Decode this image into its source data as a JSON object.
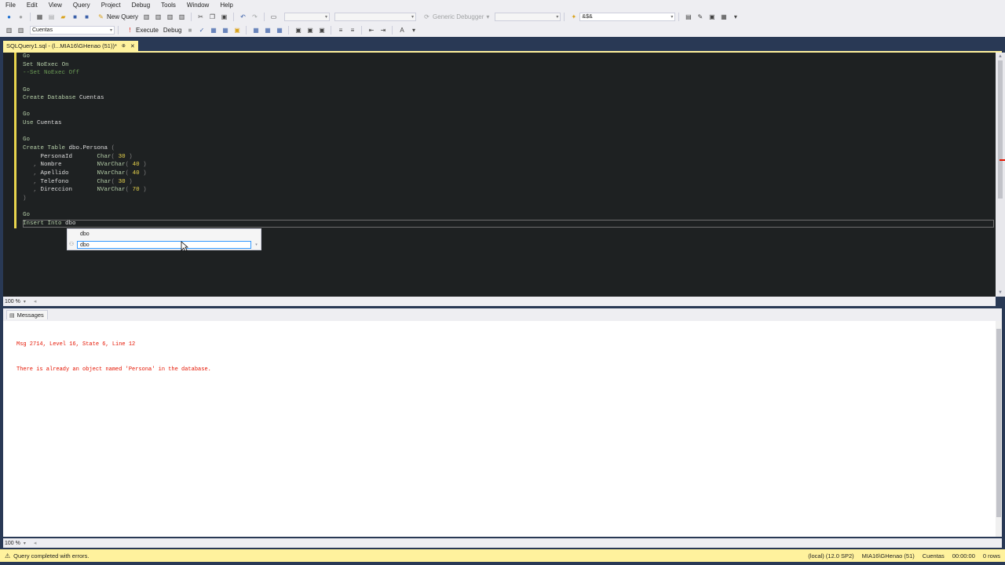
{
  "menu": [
    "File",
    "Edit",
    "View",
    "Query",
    "Project",
    "Debug",
    "Tools",
    "Window",
    "Help"
  ],
  "toolbar1": {
    "new_query_label": "New Query",
    "debugger_label": "Generic Debugger",
    "search_value": "&$&"
  },
  "toolbar2": {
    "database_value": "Cuentas",
    "execute_label": "Execute",
    "debug_label": "Debug"
  },
  "document_tab": {
    "title": "SQLQuery1.sql - (l...MIA16\\GHenao (51))*"
  },
  "editor": {
    "lines": [
      "Go",
      "Set NoExec On",
      "--Set NoExec Off",
      "",
      "Go",
      "Create Database Cuentas",
      "",
      "Go",
      "Use Cuentas",
      "",
      "Go",
      "Create Table dbo.Persona (",
      "     PersonaId       Char( 30 )",
      "   , Nombre          NVarChar( 40 )",
      "   , Apellido        NVarChar( 40 )",
      "   , Telefono        Char( 30 )",
      "   , Direccion       NVarChar( 70 )",
      ")",
      "",
      "Go",
      "Insert Into dbo"
    ],
    "zoom": "100 %"
  },
  "autocomplete": {
    "item1": "dbo",
    "item2": "dbo"
  },
  "messages": {
    "tab_label": "Messages",
    "lines": [
      "Msg 2714, Level 16, State 6, Line 12",
      "There is already an object named 'Persona' in the database."
    ],
    "zoom": "100 %"
  },
  "status": {
    "message": "Query completed with errors.",
    "server": "(local) (12.0 SP2)",
    "user": "MIA16\\GHenao (51)",
    "database": "Cuentas",
    "elapsed": "00:00:00",
    "rows": "0 rows"
  },
  "colors": {
    "tab_accent": "#fff29d",
    "editor_bg": "#1e2122",
    "error_text": "#e51400",
    "frame": "#293955"
  }
}
